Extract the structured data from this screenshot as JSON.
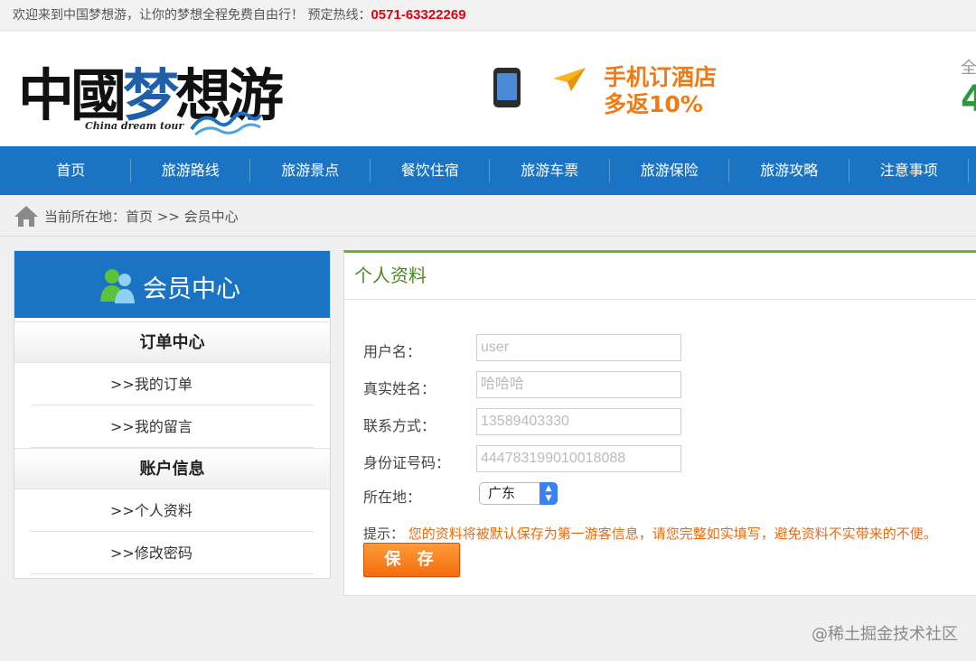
{
  "topbar": {
    "welcome": "欢迎来到中国梦想游，让你的梦想全程免费自由行！ 预定热线：",
    "hotline": "0571-63322269"
  },
  "logo": {
    "text_1": "中國",
    "text_2": "梦",
    "text_3": "想游",
    "subtitle": "China dream tour"
  },
  "promo": {
    "line1": "手机订酒店",
    "line2": "多返10%"
  },
  "header_edge": {
    "text": "全",
    "num": "4"
  },
  "nav": {
    "items": [
      "首页",
      "旅游路线",
      "旅游景点",
      "餐饮住宿",
      "旅游车票",
      "旅游保险",
      "旅游攻略",
      "注意事项"
    ]
  },
  "breadcrumb": {
    "text": "当前所在地：首页 >> 会员中心"
  },
  "sidebar": {
    "title": "会员中心",
    "sections": [
      {
        "title": "订单中心",
        "items": [
          ">>我的订单",
          ">>我的留言"
        ]
      },
      {
        "title": "账户信息",
        "items": [
          ">>个人资料",
          ">>修改密码"
        ]
      }
    ]
  },
  "profile": {
    "title": "个人资料",
    "fields": [
      {
        "label": "用户名：",
        "placeholder": "user"
      },
      {
        "label": "真实姓名：",
        "placeholder": "哈哈哈"
      },
      {
        "label": "联系方式：",
        "placeholder": "13589403330"
      },
      {
        "label": "身份证号码：",
        "placeholder": "444783199010018088"
      }
    ],
    "location_label": "所在地：",
    "location_value": "广东",
    "tip_label": "提示：",
    "tip_message": "您的资料将被默认保存为第一游客信息，请您完整如实填写，避免资料不实带来的不便。",
    "save_label": "保 存"
  },
  "watermark": "@稀土掘金技术社区",
  "colors": {
    "nav_bg": "#1b74c3",
    "accent_orange": "#f56d0a",
    "hotline_red": "#e60012",
    "title_green": "#4a8a1a"
  }
}
